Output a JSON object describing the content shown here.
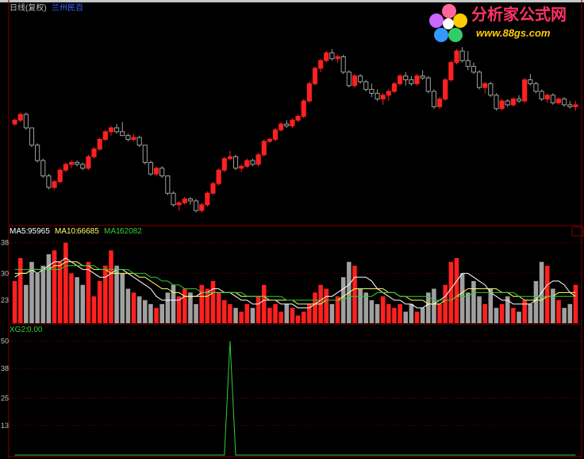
{
  "header": {
    "chart_name": "日线(复权)",
    "stock_name": "兰州民百"
  },
  "watermark": {
    "site_name": "分析家公式网",
    "site_url": "www.88gs.com"
  },
  "volume_legend": {
    "ma5_label": "MA5:",
    "ma5_value": "95965",
    "ma10_label": "MA10:",
    "ma10_value": "66685",
    "ma1_label": "MA1:",
    "ma1_value": "62082"
  },
  "indicator_legend": {
    "name": "XG2:",
    "value": "0.00"
  },
  "colors": {
    "up": "#ff2020",
    "down": "#a0a0a0",
    "ma5": "#ffffff",
    "ma10": "#ffff66",
    "ma1": "#33cc33",
    "grid": "#800000",
    "indicator": "#33cc33"
  },
  "chart_data": [
    {
      "type": "candlestick",
      "title": "日线(复权)",
      "count": 100,
      "ylim": [
        0,
        100
      ],
      "ohlc": [
        [
          52,
          55,
          51,
          54
        ],
        [
          54,
          58,
          53,
          57
        ],
        [
          57,
          58,
          49,
          50
        ],
        [
          50,
          50,
          40,
          41
        ],
        [
          41,
          42,
          32,
          33
        ],
        [
          33,
          34,
          24,
          25
        ],
        [
          25,
          26,
          18,
          19
        ],
        [
          19,
          23,
          18,
          22
        ],
        [
          22,
          29,
          21,
          28
        ],
        [
          28,
          32,
          27,
          31
        ],
        [
          31,
          33,
          29,
          32
        ],
        [
          32,
          33,
          30,
          31
        ],
        [
          31,
          32,
          28,
          29
        ],
        [
          29,
          36,
          28,
          35
        ],
        [
          35,
          40,
          34,
          39
        ],
        [
          39,
          45,
          38,
          44
        ],
        [
          44,
          49,
          43,
          48
        ],
        [
          48,
          51,
          46,
          50
        ],
        [
          50,
          52,
          47,
          48
        ],
        [
          48,
          53,
          46,
          46
        ],
        [
          46,
          47,
          43,
          44
        ],
        [
          44,
          47,
          43,
          45
        ],
        [
          45,
          46,
          40,
          41
        ],
        [
          41,
          41,
          31,
          32
        ],
        [
          32,
          33,
          25,
          26
        ],
        [
          26,
          30,
          25,
          29
        ],
        [
          29,
          30,
          24,
          25
        ],
        [
          25,
          25,
          15,
          16
        ],
        [
          16,
          17,
          9,
          10
        ],
        [
          10,
          12,
          7,
          11
        ],
        [
          11,
          14,
          10,
          13
        ],
        [
          13,
          14,
          10,
          12
        ],
        [
          12,
          13,
          6,
          7
        ],
        [
          7,
          11,
          6,
          10
        ],
        [
          10,
          17,
          9,
          16
        ],
        [
          16,
          22,
          15,
          21
        ],
        [
          21,
          29,
          20,
          28
        ],
        [
          28,
          35,
          27,
          34
        ],
        [
          34,
          38,
          33,
          35
        ],
        [
          35,
          36,
          28,
          29
        ],
        [
          29,
          31,
          27,
          30
        ],
        [
          30,
          34,
          29,
          33
        ],
        [
          33,
          34,
          30,
          31
        ],
        [
          31,
          37,
          30,
          36
        ],
        [
          36,
          44,
          35,
          43
        ],
        [
          43,
          45,
          42,
          44
        ],
        [
          44,
          50,
          43,
          49
        ],
        [
          49,
          53,
          48,
          52
        ],
        [
          52,
          54,
          50,
          51
        ],
        [
          51,
          55,
          50,
          54
        ],
        [
          54,
          57,
          53,
          56
        ],
        [
          56,
          65,
          55,
          64
        ],
        [
          64,
          74,
          63,
          73
        ],
        [
          73,
          82,
          72,
          81
        ],
        [
          81,
          86,
          79,
          85
        ],
        [
          85,
          90,
          84,
          89
        ],
        [
          89,
          91,
          85,
          86
        ],
        [
          86,
          88,
          84,
          87
        ],
        [
          87,
          88,
          78,
          79
        ],
        [
          79,
          80,
          71,
          72
        ],
        [
          72,
          78,
          71,
          77
        ],
        [
          77,
          78,
          73,
          74
        ],
        [
          74,
          75,
          69,
          70
        ],
        [
          70,
          73,
          66,
          68
        ],
        [
          68,
          70,
          64,
          65
        ],
        [
          65,
          68,
          62,
          67
        ],
        [
          67,
          70,
          64,
          69
        ],
        [
          69,
          74,
          68,
          73
        ],
        [
          73,
          78,
          72,
          77
        ],
        [
          77,
          79,
          72,
          75
        ],
        [
          75,
          77,
          72,
          73
        ],
        [
          73,
          78,
          72,
          77
        ],
        [
          77,
          80,
          75,
          76
        ],
        [
          76,
          77,
          68,
          69
        ],
        [
          69,
          70,
          60,
          61
        ],
        [
          61,
          66,
          60,
          65
        ],
        [
          65,
          76,
          64,
          75
        ],
        [
          75,
          85,
          74,
          84
        ],
        [
          84,
          91,
          83,
          90
        ],
        [
          90,
          92,
          84,
          85
        ],
        [
          85,
          90,
          80,
          82
        ],
        [
          82,
          84,
          78,
          79
        ],
        [
          79,
          80,
          70,
          71
        ],
        [
          71,
          74,
          68,
          73
        ],
        [
          73,
          74,
          66,
          67
        ],
        [
          67,
          68,
          59,
          60
        ],
        [
          60,
          65,
          59,
          64
        ],
        [
          64,
          65,
          61,
          62
        ],
        [
          62,
          66,
          61,
          65
        ],
        [
          65,
          67,
          63,
          64
        ],
        [
          64,
          76,
          63,
          75
        ],
        [
          75,
          78,
          72,
          73
        ],
        [
          73,
          74,
          68,
          69
        ],
        [
          69,
          70,
          64,
          65
        ],
        [
          65,
          68,
          63,
          67
        ],
        [
          67,
          68,
          62,
          63
        ],
        [
          63,
          66,
          62,
          65
        ],
        [
          65,
          66,
          61,
          62
        ],
        [
          62,
          64,
          60,
          61
        ],
        [
          61,
          64,
          59,
          62
        ]
      ]
    },
    {
      "type": "bar",
      "title": "",
      "yticks": [
        23,
        30,
        38
      ],
      "ylim": [
        17,
        40
      ],
      "volume": [
        28,
        34,
        27,
        33,
        30,
        32,
        35,
        36,
        33,
        38,
        30,
        29,
        27,
        33,
        24,
        28,
        32,
        36,
        32,
        30,
        26,
        25,
        24,
        23,
        22,
        21,
        22,
        25,
        27,
        24,
        26,
        25,
        22,
        27,
        26,
        28,
        25,
        23,
        22,
        21,
        20,
        22,
        21,
        24,
        27,
        21,
        22,
        20,
        22,
        21,
        19,
        20,
        22,
        25,
        27,
        26,
        22,
        24,
        29,
        33,
        32,
        26,
        25,
        23,
        22,
        24,
        22,
        21,
        22,
        20,
        22,
        20,
        21,
        25,
        26,
        22,
        27,
        33,
        34,
        30,
        25,
        28,
        24,
        22,
        26,
        21,
        22,
        24,
        21,
        20,
        23,
        22,
        28,
        33,
        32,
        26,
        23,
        21,
        22,
        27
      ],
      "series": [
        {
          "name": "MA5",
          "values": [
            29,
            30,
            30,
            31,
            30,
            31,
            32,
            33,
            33,
            34,
            33,
            32,
            31,
            31,
            30,
            29,
            29,
            30,
            31,
            31,
            30,
            29,
            28,
            27,
            26,
            24,
            23,
            23,
            23,
            23,
            24,
            24,
            24,
            25,
            25,
            26,
            26,
            25,
            25,
            24,
            23,
            23,
            22,
            22,
            23,
            23,
            23,
            22,
            22,
            22,
            21,
            21,
            21,
            22,
            23,
            24,
            24,
            25,
            26,
            27,
            29,
            29,
            29,
            28,
            26,
            25,
            24,
            23,
            23,
            22,
            22,
            21,
            21,
            22,
            22,
            23,
            24,
            26,
            28,
            30,
            30,
            29,
            28,
            27,
            25,
            24,
            23,
            23,
            22,
            22,
            22,
            22,
            23,
            25,
            27,
            28,
            28,
            27,
            25,
            24
          ]
        },
        {
          "name": "MA10",
          "values": [
            30,
            30,
            30,
            31,
            31,
            31,
            31,
            32,
            32,
            33,
            33,
            33,
            32,
            32,
            31,
            31,
            31,
            30,
            30,
            30,
            30,
            30,
            29,
            29,
            28,
            27,
            26,
            26,
            25,
            25,
            24,
            24,
            24,
            24,
            24,
            25,
            25,
            25,
            25,
            25,
            24,
            24,
            24,
            24,
            24,
            23,
            23,
            23,
            23,
            23,
            22,
            22,
            22,
            22,
            22,
            23,
            23,
            23,
            24,
            25,
            26,
            26,
            26,
            26,
            26,
            26,
            25,
            25,
            24,
            24,
            23,
            23,
            23,
            22,
            22,
            22,
            23,
            23,
            24,
            25,
            26,
            26,
            26,
            26,
            26,
            26,
            25,
            25,
            24,
            24,
            23,
            23,
            23,
            23,
            24,
            24,
            25,
            25,
            25,
            25
          ]
        },
        {
          "name": "MA1",
          "values": [
            31,
            31,
            31,
            31,
            31,
            31,
            31,
            31,
            31,
            32,
            32,
            32,
            32,
            32,
            32,
            31,
            31,
            31,
            31,
            31,
            31,
            30,
            30,
            30,
            29,
            29,
            28,
            28,
            27,
            27,
            26,
            26,
            26,
            25,
            25,
            25,
            25,
            25,
            25,
            25,
            25,
            24,
            24,
            24,
            24,
            24,
            24,
            24,
            23,
            23,
            23,
            23,
            23,
            23,
            23,
            23,
            23,
            23,
            23,
            24,
            24,
            24,
            24,
            24,
            25,
            25,
            25,
            25,
            24,
            24,
            24,
            24,
            24,
            24,
            23,
            23,
            23,
            23,
            24,
            24,
            24,
            25,
            25,
            25,
            25,
            25,
            25,
            25,
            25,
            24,
            24,
            24,
            24,
            24,
            24,
            24,
            24,
            24,
            24,
            24
          ]
        }
      ]
    },
    {
      "type": "line",
      "title": "",
      "yticks": [
        13,
        25,
        38,
        50
      ],
      "ylim": [
        0,
        52
      ],
      "series": [
        {
          "name": "XG2",
          "values": [
            0,
            0,
            0,
            0,
            0,
            0,
            0,
            0,
            0,
            0,
            0,
            0,
            0,
            0,
            0,
            0,
            0,
            0,
            0,
            0,
            0,
            0,
            0,
            0,
            0,
            0,
            0,
            0,
            0,
            0,
            0,
            0,
            0,
            0,
            0,
            0,
            0,
            0,
            50,
            0,
            0,
            0,
            0,
            0,
            0,
            0,
            0,
            0,
            0,
            0,
            0,
            0,
            0,
            0,
            0,
            0,
            0,
            0,
            0,
            0,
            0,
            0,
            0,
            0,
            0,
            0,
            0,
            0,
            0,
            0,
            0,
            0,
            0,
            0,
            0,
            0,
            0,
            0,
            0,
            0,
            0,
            0,
            0,
            0,
            0,
            0,
            0,
            0,
            0,
            0,
            0,
            0,
            0,
            0,
            0,
            0,
            0,
            0,
            0,
            0
          ]
        }
      ]
    }
  ]
}
